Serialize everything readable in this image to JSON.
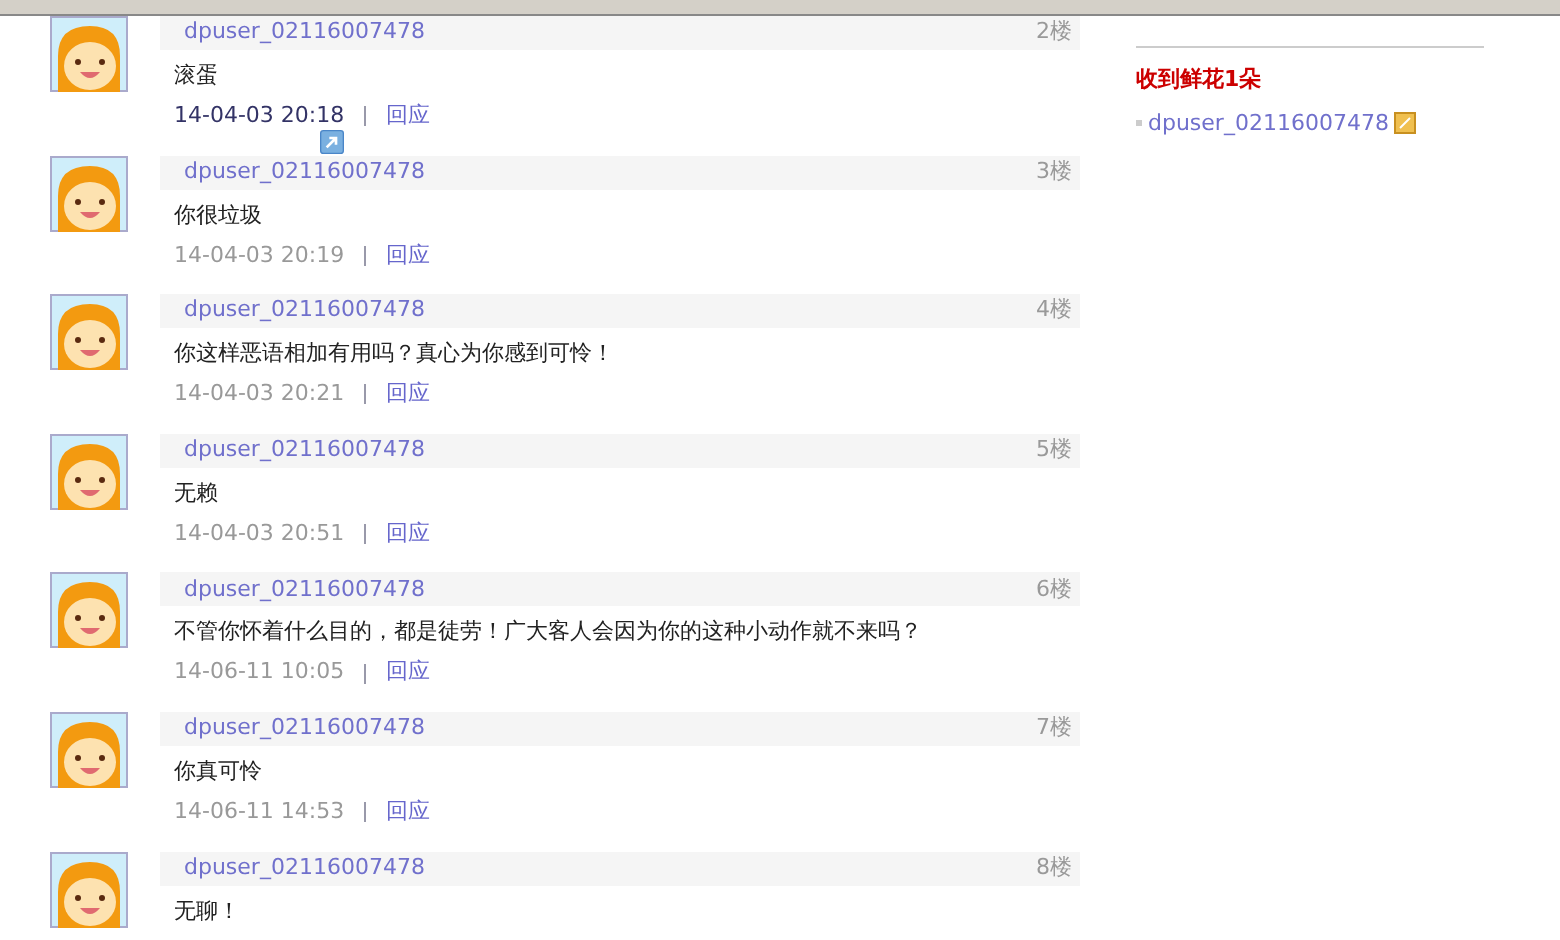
{
  "posts": [
    {
      "user": "dpuser_02116007478",
      "floor": "2楼",
      "text": "滚蛋",
      "time": "14-04-03 20:18",
      "highlighted": true,
      "reply": "回应"
    },
    {
      "user": "dpuser_02116007478",
      "floor": "3楼",
      "text": "你很垃圾",
      "time": "14-04-03 20:19",
      "highlighted": false,
      "reply": "回应"
    },
    {
      "user": "dpuser_02116007478",
      "floor": "4楼",
      "text": "你这样恶语相加有用吗？真心为你感到可怜！",
      "time": "14-04-03 20:21",
      "highlighted": false,
      "reply": "回应"
    },
    {
      "user": "dpuser_02116007478",
      "floor": "5楼",
      "text": "无赖",
      "time": "14-04-03 20:51",
      "highlighted": false,
      "reply": "回应"
    },
    {
      "user": "dpuser_02116007478",
      "floor": "6楼",
      "text": "不管你怀着什么目的，都是徒劳！广大客人会因为你的这种小动作就不来吗？",
      "time": "14-06-11 10:05",
      "highlighted": false,
      "reply": "回应"
    },
    {
      "user": "dpuser_02116007478",
      "floor": "7楼",
      "text": "你真可怜",
      "time": "14-06-11 14:53",
      "highlighted": false,
      "reply": "回应"
    },
    {
      "user": "dpuser_02116007478",
      "floor": "8楼",
      "text": "无聊！"
    }
  ],
  "sidebar": {
    "title": "收到鲜花1朵",
    "items": [
      {
        "user": "dpuser_02116007478"
      }
    ]
  }
}
